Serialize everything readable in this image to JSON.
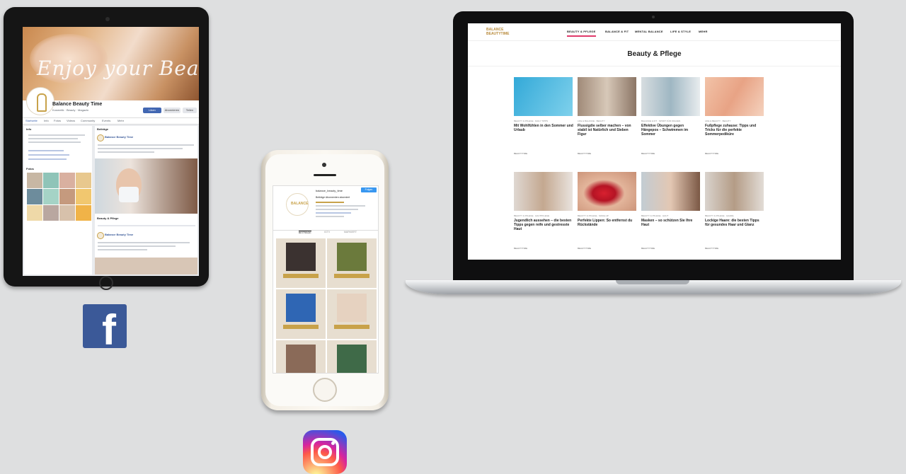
{
  "facebook": {
    "cover_text": "Enjoy your Beauty",
    "page_name": "Balance Beauty Time",
    "page_sub": "Kosmetik · Beauty · Magazin",
    "buttons": [
      "Liken",
      "Abonnieren",
      "Teilen"
    ],
    "tabs": [
      "Startseite",
      "Info",
      "Fotos",
      "Videos",
      "Community",
      "Events",
      "Mehr"
    ],
    "sidebar_heading": "Info",
    "feed_heading": "Beiträge",
    "photos_heading": "Fotos",
    "post_author": "Balance Beauty Time",
    "post_author_2": "Balance Beauty Time",
    "post_link_title": "Beauty & Pflege",
    "brand_color": "#3b5998"
  },
  "facebook_icon": {
    "icon": "facebook-icon",
    "glyph": "f",
    "color": "#3b5998"
  },
  "instagram": {
    "username": "balance_beauty_time",
    "follow_label": "Folgen",
    "stats": "Beiträge   Abonnenten   abonniert",
    "avatar_text": "BALANCE",
    "tabs": [
      "BEITRÄGE",
      "IGTV",
      "MARKIERT"
    ],
    "accent_color": "#3897f0"
  },
  "instagram_icon": {
    "icon": "instagram-icon"
  },
  "website": {
    "logo_line1": "BALANCE",
    "logo_line2": "BEAUTYTIME",
    "nav": [
      "BEAUTY & PFLEGE",
      "BALANCE & FIT",
      "MENTAL BALANCE",
      "LIFE & STYLE",
      "MEHR"
    ],
    "active_nav_color": "#e03a6b",
    "page_title": "Beauty & Pflege",
    "cards": [
      {
        "category": "BEAUTY & PFLEGE · DAILY TIPPS",
        "title": "Mit Wohlfühlen in den Sommer und Urlaub",
        "meta": "BEAUTYTIME"
      },
      {
        "category": "LIFE & BALANCE · BEAUTY",
        "title": "Flussigdie selber machen – von stabil ist Natürlich und Sieben Figur",
        "meta": "BEAUTYTIME"
      },
      {
        "category": "BALANCE & FIT · SPORT FÜR FRAUEN",
        "title": "Effektive Übungen gegen Hängepos – Schwimmen im Sommer",
        "meta": "BEAUTYTIME"
      },
      {
        "category": "LIFE & BEAUTY · BEAUTY",
        "title": "Fußpflege zuhause: Tipps und Tricks für die perfekte Sommerpediküre",
        "meta": "BEAUTYTIME"
      },
      {
        "category": "BEAUTY & PFLEGE · HAUTPFLEGE",
        "title": "Jugendlich aussehen – die besten Tipps gegen reife und gestresste Haut",
        "meta": "BEAUTYTIME"
      },
      {
        "category": "BEAUTY & PFLEGE · MAKE-UP",
        "title": "Perfekte Lippen: So entfernst du Rückstände",
        "meta": "BEAUTYTIME"
      },
      {
        "category": "BEAUTY & PFLEGE · HAUT",
        "title": "Masken – so schützen Sie Ihre Haut",
        "meta": "BEAUTYTIME"
      },
      {
        "category": "BEAUTY & PFLEGE · HAARE",
        "title": "Lockige Haare: die besten Tipps für gesundes Haar und Glanz",
        "meta": "BEAUTYTIME"
      }
    ]
  }
}
